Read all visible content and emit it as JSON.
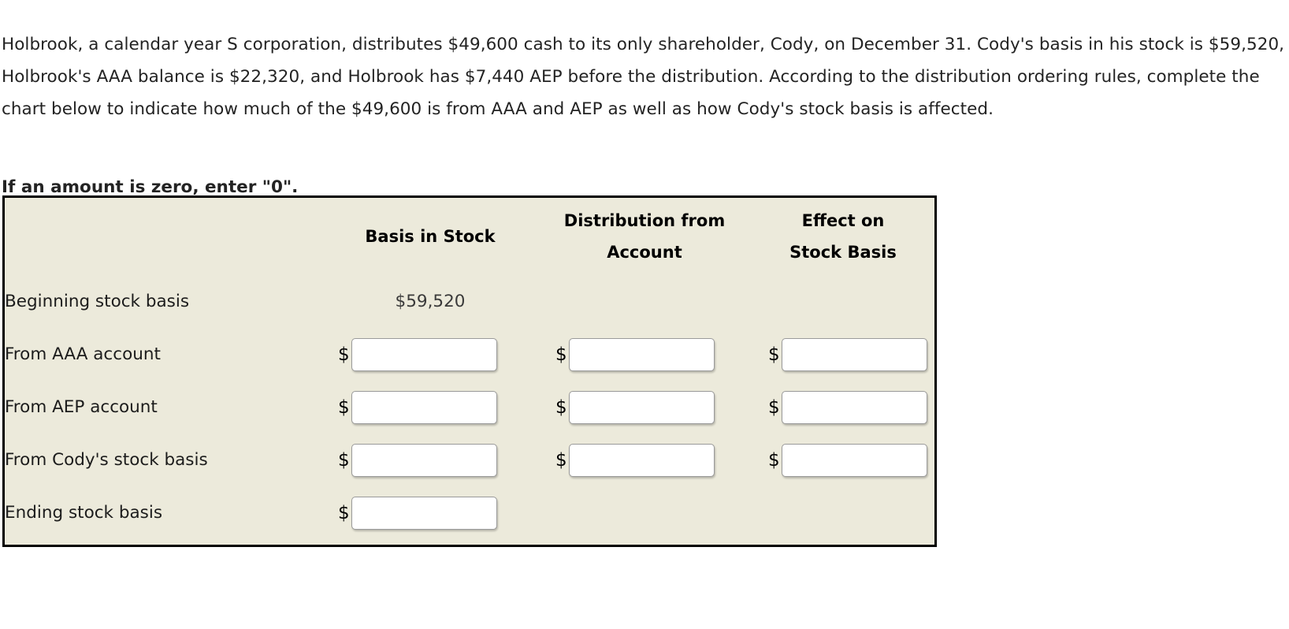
{
  "problem": {
    "statement": "Holbrook, a calendar year S corporation, distributes $49,600 cash to its only shareholder, Cody, on December 31. Cody's basis in his stock is $59,520, Holbrook's AAA balance is $22,320, and Holbrook has $7,440 AEP before the distribution. According to the distribution ordering rules, complete the chart below to indicate how much of the $49,600 is from AAA and AEP as well as how Cody's stock basis is affected.",
    "zero_note": "If an amount is zero, enter \"0\"."
  },
  "chart_data": {
    "type": "table",
    "title": "",
    "columns": [
      {
        "line1": "",
        "line2": ""
      },
      {
        "line1": "",
        "line2": "Basis in Stock"
      },
      {
        "line1": "Distribution from",
        "line2": "Account"
      },
      {
        "line1": "Effect on",
        "line2": "Stock Basis"
      }
    ],
    "rows": [
      {
        "label": "Beginning stock basis",
        "basis_in_stock": {
          "kind": "static",
          "value": "$59,520"
        },
        "distribution_from_account": {
          "kind": "empty"
        },
        "effect_on_stock_basis": {
          "kind": "empty"
        }
      },
      {
        "label": "From AAA account",
        "basis_in_stock": {
          "kind": "input",
          "prefix": "$",
          "value": "",
          "placeholder": ""
        },
        "distribution_from_account": {
          "kind": "input",
          "prefix": "$",
          "value": "",
          "placeholder": ""
        },
        "effect_on_stock_basis": {
          "kind": "input",
          "prefix": "$",
          "value": "",
          "placeholder": ""
        }
      },
      {
        "label": "From AEP account",
        "basis_in_stock": {
          "kind": "input",
          "prefix": "$",
          "value": "",
          "placeholder": ""
        },
        "distribution_from_account": {
          "kind": "input",
          "prefix": "$",
          "value": "",
          "placeholder": ""
        },
        "effect_on_stock_basis": {
          "kind": "input",
          "prefix": "$",
          "value": "",
          "placeholder": ""
        }
      },
      {
        "label": "From Cody's stock basis",
        "basis_in_stock": {
          "kind": "input",
          "prefix": "$",
          "value": "",
          "placeholder": ""
        },
        "distribution_from_account": {
          "kind": "input",
          "prefix": "$",
          "value": "",
          "placeholder": ""
        },
        "effect_on_stock_basis": {
          "kind": "input",
          "prefix": "$",
          "value": "",
          "placeholder": ""
        }
      },
      {
        "label": "Ending stock basis",
        "basis_in_stock": {
          "kind": "input",
          "prefix": "$",
          "value": "",
          "placeholder": ""
        },
        "distribution_from_account": {
          "kind": "empty"
        },
        "effect_on_stock_basis": {
          "kind": "empty"
        }
      }
    ]
  },
  "colors": {
    "chart_background": "#ECEADB",
    "chart_border": "#000000",
    "page_background": "#FFFFFF",
    "text": "#232323",
    "input_background": "#FFFFFF",
    "input_border": "#9A9A9A"
  }
}
